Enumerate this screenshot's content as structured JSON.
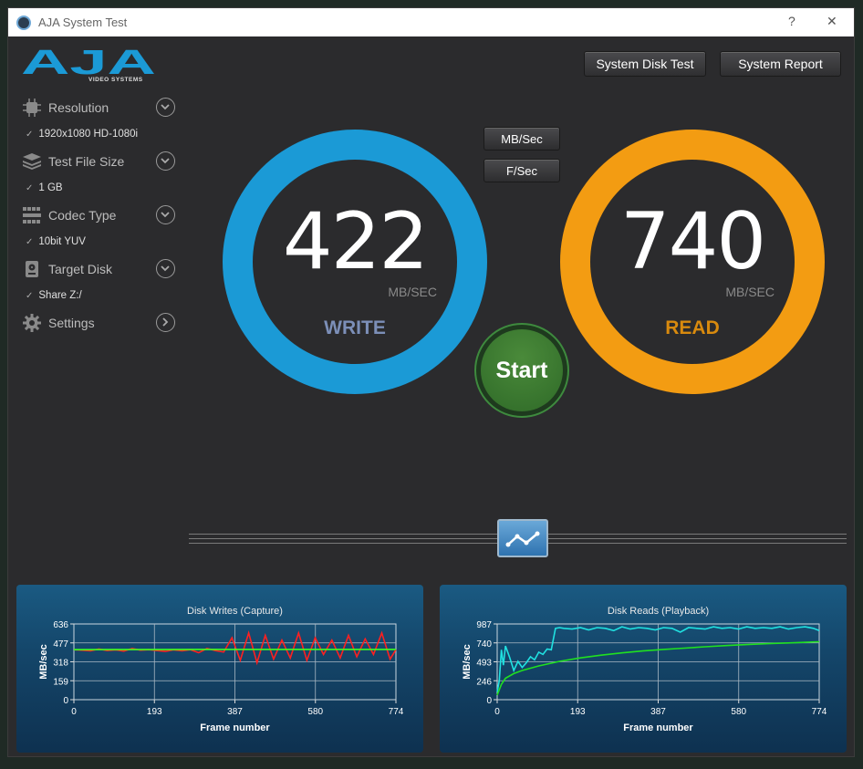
{
  "window": {
    "title": "AJA System Test",
    "help": "?",
    "close": "✕"
  },
  "logo": {
    "text": "AJA",
    "subtitle": "VIDEO SYSTEMS"
  },
  "sidebar": {
    "items": [
      {
        "label": "Resolution",
        "value": "1920x1080 HD-1080i",
        "icon": "chip-icon"
      },
      {
        "label": "Test File Size",
        "value": "1 GB",
        "icon": "stack-icon"
      },
      {
        "label": "Codec Type",
        "value": "10bit YUV",
        "icon": "grid-icon"
      },
      {
        "label": "Target Disk",
        "value": "Share Z:/",
        "icon": "disk-icon"
      },
      {
        "label": "Settings",
        "value": "",
        "icon": "gear-icon"
      }
    ]
  },
  "toolbar": {
    "system_disk_test": "System Disk Test",
    "system_report": "System Report"
  },
  "units": {
    "mbsec": "MB/Sec",
    "fsec": "F/Sec"
  },
  "write": {
    "value": "422",
    "unit": "MB/SEC",
    "label": "WRITE",
    "color": "#1b9ad6"
  },
  "read": {
    "value": "740",
    "unit": "MB/SEC",
    "label": "READ",
    "color": "#f39c12"
  },
  "start": {
    "label": "Start"
  },
  "chart_data": [
    {
      "type": "line",
      "title": "Disk Writes (Capture)",
      "xlabel": "Frame number",
      "ylabel": "MB/sec",
      "xlim": [
        0,
        774
      ],
      "ylim": [
        0,
        636
      ],
      "xticks": [
        "0",
        "193",
        "387",
        "580",
        "774"
      ],
      "yticks": [
        "0",
        "159",
        "318",
        "477",
        "636"
      ],
      "series": [
        {
          "color": "#ff2020",
          "x": [
            0,
            20,
            40,
            60,
            80,
            100,
            120,
            140,
            160,
            180,
            200,
            220,
            240,
            260,
            280,
            300,
            320,
            340,
            360,
            380,
            400,
            420,
            440,
            460,
            480,
            500,
            520,
            540,
            560,
            580,
            600,
            620,
            640,
            660,
            680,
            700,
            720,
            740,
            760,
            774
          ],
          "values": [
            420,
            415,
            410,
            425,
            412,
            418,
            408,
            430,
            415,
            420,
            412,
            405,
            418,
            410,
            420,
            395,
            430,
            412,
            400,
            520,
            330,
            560,
            310,
            540,
            340,
            500,
            350,
            560,
            330,
            520,
            380,
            500,
            350,
            540,
            360,
            510,
            380,
            560,
            340,
            420
          ]
        },
        {
          "color": "#40ff20",
          "x": [
            0,
            100,
            200,
            300,
            400,
            500,
            600,
            700,
            774
          ],
          "values": [
            420,
            421,
            421,
            422,
            422,
            422,
            422,
            422,
            422
          ]
        }
      ]
    },
    {
      "type": "line",
      "title": "Disk Reads (Playback)",
      "xlabel": "Frame number",
      "ylabel": "MB/sec",
      "xlim": [
        0,
        774
      ],
      "ylim": [
        0,
        987
      ],
      "xticks": [
        "0",
        "193",
        "387",
        "580",
        "774"
      ],
      "yticks": [
        "0",
        "246",
        "493",
        "740",
        "987"
      ],
      "series": [
        {
          "color": "#20e0e0",
          "x": [
            0,
            5,
            10,
            15,
            20,
            30,
            40,
            50,
            60,
            70,
            80,
            90,
            100,
            110,
            120,
            130,
            140,
            150,
            160,
            180,
            200,
            220,
            240,
            260,
            280,
            300,
            320,
            340,
            360,
            380,
            400,
            420,
            440,
            460,
            480,
            500,
            520,
            540,
            560,
            580,
            600,
            620,
            640,
            660,
            680,
            700,
            720,
            740,
            760,
            774
          ],
          "values": [
            100,
            250,
            650,
            450,
            700,
            550,
            380,
            500,
            420,
            480,
            560,
            520,
            620,
            590,
            660,
            650,
            930,
            940,
            930,
            920,
            940,
            910,
            940,
            930,
            900,
            950,
            920,
            940,
            930,
            910,
            940,
            930,
            880,
            940,
            930,
            920,
            950,
            930,
            940,
            920,
            950,
            930,
            940,
            930,
            950,
            920,
            940,
            950,
            930,
            900
          ]
        },
        {
          "color": "#20e020",
          "x": [
            0,
            10,
            20,
            40,
            60,
            100,
            150,
            200,
            250,
            300,
            350,
            400,
            450,
            500,
            550,
            600,
            650,
            700,
            774
          ],
          "values": [
            60,
            200,
            280,
            340,
            380,
            440,
            500,
            545,
            580,
            610,
            635,
            655,
            672,
            690,
            705,
            718,
            730,
            740,
            755
          ]
        }
      ]
    }
  ]
}
